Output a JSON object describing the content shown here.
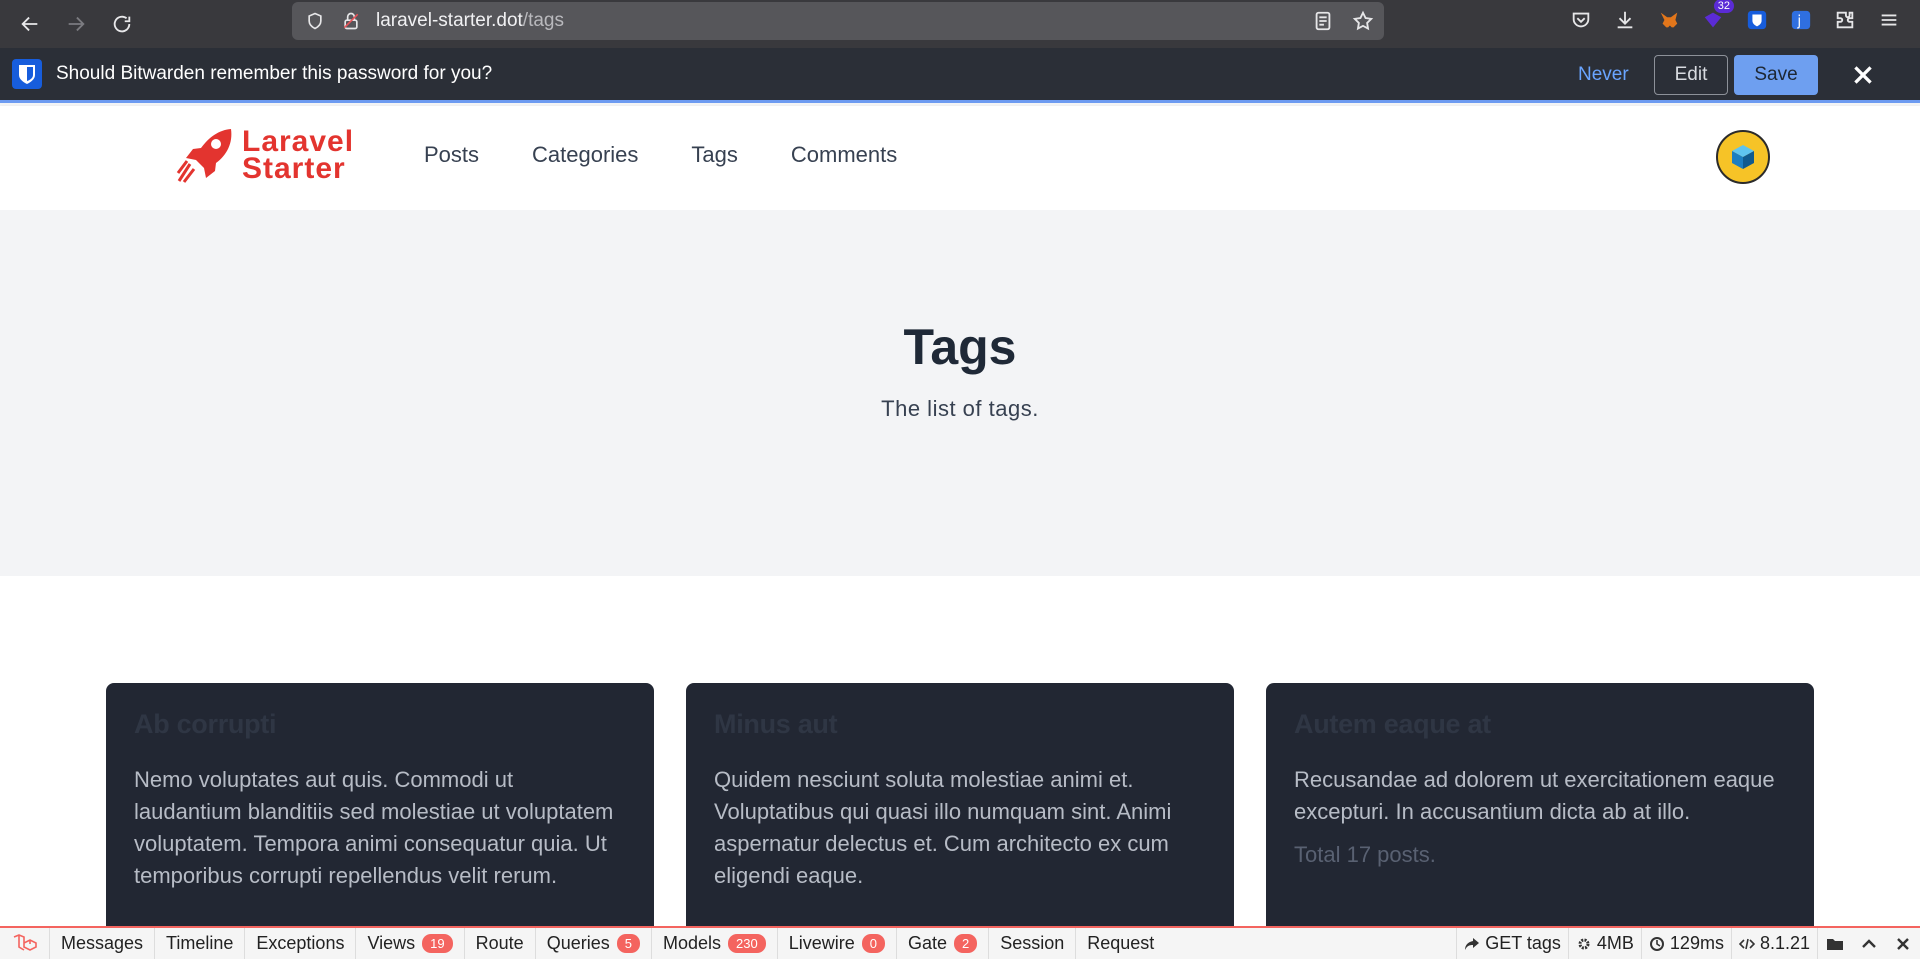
{
  "browser": {
    "url_host": "laravel-starter.dot",
    "url_path": "/tags",
    "extension_badge": "32"
  },
  "bitwarden": {
    "message": "Should Bitwarden remember this password for you?",
    "never_label": "Never",
    "edit_label": "Edit",
    "save_label": "Save"
  },
  "site": {
    "logo_line1": "Laravel",
    "logo_line2": "Starter",
    "nav": [
      "Posts",
      "Categories",
      "Tags",
      "Comments"
    ]
  },
  "hero": {
    "title": "Tags",
    "subtitle": "The list of tags."
  },
  "cards": [
    {
      "title": "Ab corrupti",
      "body": "Nemo voluptates aut quis. Commodi ut laudantium blanditiis sed molestiae ut voluptatem voluptatem. Tempora animi consequatur quia. Ut temporibus corrupti repellendus velit rerum.",
      "total": ""
    },
    {
      "title": "Minus aut",
      "body": "Quidem nesciunt soluta molestiae animi et. Voluptatibus qui quasi illo numquam sint. Animi aspernatur delectus et. Cum architecto ex cum eligendi eaque.",
      "total": ""
    },
    {
      "title": "Autem eaque at",
      "body": "Recusandae ad dolorem ut exercitationem eaque excepturi. In accusantium dicta ab at illo.",
      "total": "Total 17 posts."
    }
  ],
  "debugbar": {
    "tabs": [
      {
        "label": "Messages",
        "count": ""
      },
      {
        "label": "Timeline",
        "count": ""
      },
      {
        "label": "Exceptions",
        "count": ""
      },
      {
        "label": "Views",
        "count": "19"
      },
      {
        "label": "Route",
        "count": ""
      },
      {
        "label": "Queries",
        "count": "5"
      },
      {
        "label": "Models",
        "count": "230"
      },
      {
        "label": "Livewire",
        "count": "0"
      },
      {
        "label": "Gate",
        "count": "2"
      },
      {
        "label": "Session",
        "count": ""
      },
      {
        "label": "Request",
        "count": ""
      }
    ],
    "request": "GET tags",
    "memory": "4MB",
    "time": "129ms",
    "php_version": "8.1.21"
  },
  "colors": {
    "brand": "#e3342f",
    "bitwarden_accent": "#6e9ff0",
    "card_bg": "#222733",
    "debug_badge": "#f4645f"
  }
}
